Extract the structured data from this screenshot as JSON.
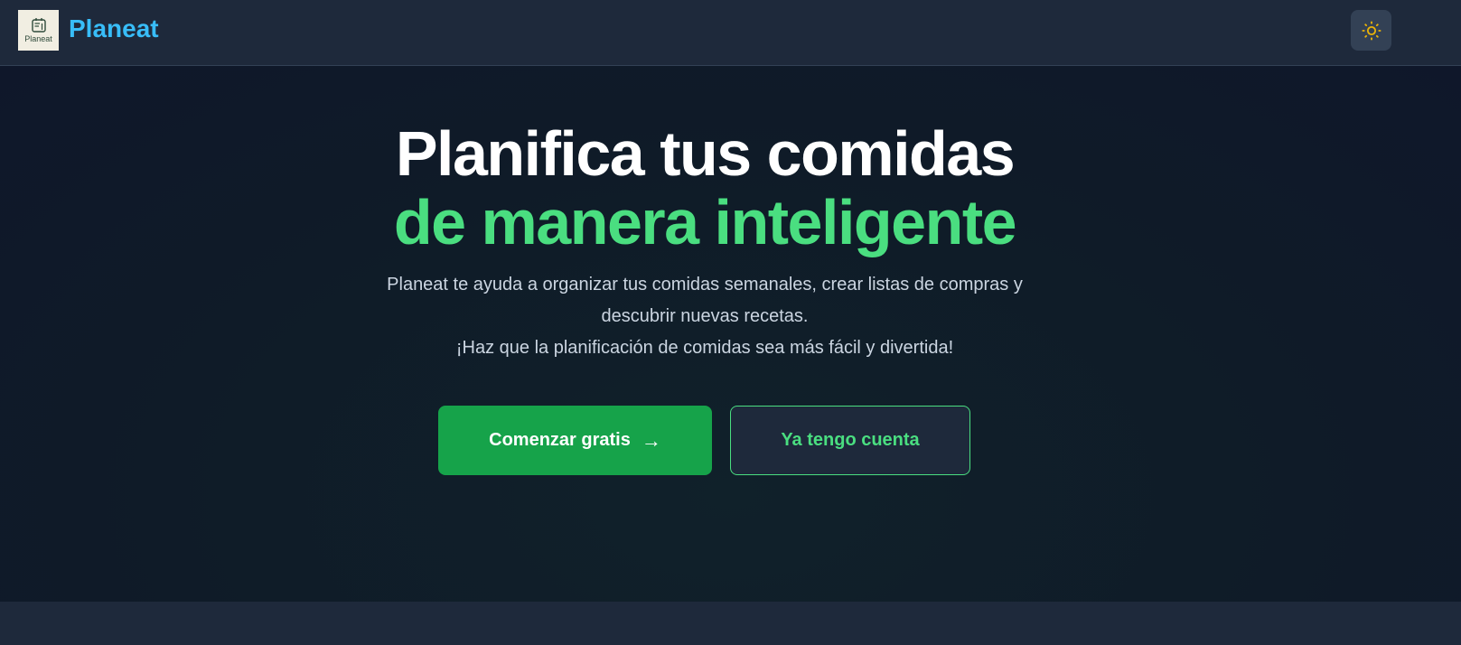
{
  "header": {
    "logo_text": "Planeat",
    "brand": "Planeat",
    "theme_toggle_icon": "sun-icon"
  },
  "hero": {
    "title_line1": "Planifica tus comidas",
    "title_line2": "de manera inteligente",
    "description_line1": "Planeat te ayuda a organizar tus comidas semanales, crear listas de compras y",
    "description_line2": "descubrir nuevas recetas.",
    "description_line3": "¡Haz que la planificación de comidas sea más fácil y divertida!",
    "primary_button": "Comenzar gratis",
    "primary_button_icon": "arrow-right-icon",
    "secondary_button": "Ya tengo cuenta"
  },
  "colors": {
    "brand": "#38bdf8",
    "accent": "#4ade80",
    "primary_button": "#16a34a",
    "header_bg": "#1e293b",
    "hero_bg": "#0f172a",
    "sun": "#eab308"
  }
}
